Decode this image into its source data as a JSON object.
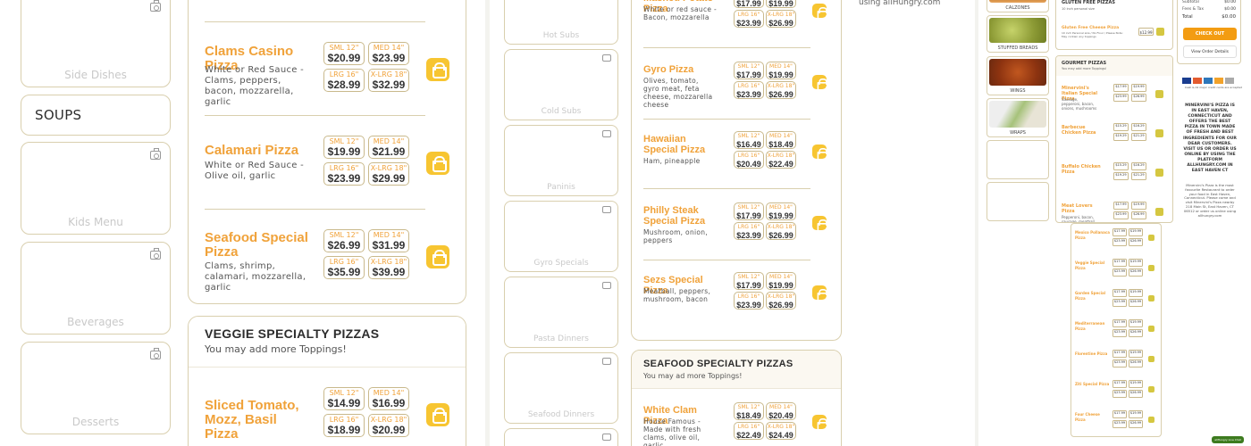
{
  "colors": {
    "accent": "#f0a23a",
    "cart": "#f7c531",
    "border": "#d9cfae",
    "checkout": "#f39c12"
  },
  "panel1": {
    "categories": [
      "Side Dishes",
      "SOUPS",
      "Kids Menu",
      "Beverages",
      "Desserts"
    ],
    "items": [
      {
        "name": "Clams Casino Pizza",
        "desc": "White or Red Sauce - Clams, peppers, bacon, mozzarella, garlic",
        "prices": [
          [
            "SML 12\"",
            "$20.99"
          ],
          [
            "MED 14\"",
            "$23.99"
          ],
          [
            "LRG 16\"",
            "$28.99"
          ],
          [
            "X-LRG 18\"",
            "$32.99"
          ]
        ]
      },
      {
        "name": "Calamari Pizza",
        "desc": "White or Red Sauce - Olive oil, garlic",
        "prices": [
          [
            "SML 12\"",
            "$19.99"
          ],
          [
            "MED 14\"",
            "$21.99"
          ],
          [
            "LRG 16\"",
            "$23.99"
          ],
          [
            "X-LRG 18\"",
            "$29.99"
          ]
        ]
      },
      {
        "name": "Seafood Special Pizza",
        "desc": "Clams, shrimp, calamari, mozzarella, garlic",
        "prices": [
          [
            "SML 12\"",
            "$26.99"
          ],
          [
            "MED 14\"",
            "$31.99"
          ],
          [
            "LRG 16\"",
            "$35.99"
          ],
          [
            "X-LRG 18\"",
            "$39.99"
          ]
        ]
      }
    ],
    "veggie": {
      "title": "VEGGIE SPECIALTY PIZZAS",
      "subtitle": "You may add more Toppings!",
      "item": {
        "name": "Sliced Tomato, Mozz, Basil Pizza",
        "prices": [
          [
            "SML 12\"",
            "$14.99"
          ],
          [
            "MED 14\"",
            "$16.99"
          ],
          [
            "LRG 16\"",
            "$18.99"
          ],
          [
            "X-LRG 18\"",
            "$20.99"
          ]
        ]
      }
    }
  },
  "panel2": {
    "categories": [
      "Hot Subs",
      "Cold Subs",
      "Paninis",
      "Gyro Specials",
      "Pasta Dinners",
      "Seafood Dinners",
      ""
    ],
    "items": [
      {
        "name": "Mashed Potato Pizza",
        "desc": "White or red sauce - Bacon, mozzarella",
        "prices": [
          [
            "SML 12\"",
            "$17.99"
          ],
          [
            "MED 14\"",
            "$19.99"
          ],
          [
            "LRG 16\"",
            "$23.99"
          ],
          [
            "X-LRG 18\"",
            "$26.99"
          ]
        ]
      },
      {
        "name": "Gyro Pizza",
        "desc": "Olives, tomato, gyro meat, feta cheese, mozzarella cheese",
        "prices": [
          [
            "SML 12\"",
            "$17.99"
          ],
          [
            "MED 14\"",
            "$19.99"
          ],
          [
            "LRG 16\"",
            "$23.99"
          ],
          [
            "X-LRG 18\"",
            "$26.99"
          ]
        ]
      },
      {
        "name": "Hawaiian Special Pizza",
        "desc": "Ham, pineapple",
        "prices": [
          [
            "SML 12\"",
            "$16.49"
          ],
          [
            "MED 14\"",
            "$18.49"
          ],
          [
            "LRG 16\"",
            "$20.49"
          ],
          [
            "X-LRG 18\"",
            "$22.49"
          ]
        ]
      },
      {
        "name": "Philly Steak Special Pizza",
        "desc": "Mushroom, onion, peppers",
        "prices": [
          [
            "SML 12\"",
            "$17.99"
          ],
          [
            "MED 14\"",
            "$19.99"
          ],
          [
            "LRG 16\"",
            "$23.99"
          ],
          [
            "X-LRG 18\"",
            "$26.99"
          ]
        ]
      },
      {
        "name": "Sezs Special Pizza",
        "desc": "Meatball, peppers, mushroom, bacon",
        "prices": [
          [
            "SML 12\"",
            "$17.99"
          ],
          [
            "MED 14\"",
            "$19.99"
          ],
          [
            "LRG 16\"",
            "$23.99"
          ],
          [
            "X-LRG 18\"",
            "$26.99"
          ]
        ]
      }
    ],
    "seafood": {
      "title": "SEAFOOD SPECIALTY PIZZAS",
      "subtitle": "You may ad more Toppings!",
      "item": {
        "name": "White Clam Pizza",
        "desc": "House Famous - Made with fresh clams, olive oil, garlic",
        "prices": [
          [
            "SML 12\"",
            "$18.49"
          ],
          [
            "MED 14\"",
            "$20.49"
          ],
          [
            "LRG 16\"",
            "$22.49"
          ],
          [
            "X-LRG 18\"",
            "$24.49"
          ]
        ]
      }
    },
    "side_text": "using allHungry.com"
  },
  "panel3": {
    "thumbs": [
      "CALZONES",
      "STUFFED BREADS",
      "WINGS",
      "WRAPS",
      "",
      ""
    ],
    "gluten": {
      "title": "GLUTEN FREE PIZZAS",
      "sub": "10 inch personal size",
      "item": "Gluten Free Cheese Pizza",
      "item_desc": "10 inch Personal size / No Flour / Please Note: May contain any toppings",
      "price": "$12.99"
    },
    "gourmet": {
      "title": "GOURMET PIZZAS",
      "sub": "You may add more Toppings!"
    },
    "gourmet_items": [
      {
        "name": "Minervini's Italian Special Pizza",
        "desc": "Sausage, pepperoni, bacon, onions, mushrooms",
        "prices": [
          "$17.99",
          "$19.99",
          "$23.99",
          "$26.99"
        ]
      },
      {
        "name": "Barbecue Chicken Pizza",
        "desc": "",
        "prices": [
          "$15.29",
          "$16.29",
          "$19.29",
          "$21.29"
        ]
      },
      {
        "name": "Buffalo Chicken Pizza",
        "desc": "",
        "prices": [
          "$15.29",
          "$16.29",
          "$19.29",
          "$21.29"
        ]
      },
      {
        "name": "Meat Lovers Pizza",
        "desc": "Pepperoni, bacon, sausage, meatball",
        "prices": [
          "$17.99",
          "$19.99",
          "$23.99",
          "$26.99"
        ]
      }
    ],
    "lower_items": [
      {
        "name": "Mexico Pollanaca Pizza",
        "prices": [
          "$17.99",
          "$19.99",
          "$23.99",
          "$26.99"
        ]
      },
      {
        "name": "Veggie Special Pizza",
        "prices": [
          "$17.99",
          "$19.99",
          "$23.99",
          "$26.99"
        ]
      },
      {
        "name": "Garden Special Pizza",
        "prices": [
          "$17.99",
          "$19.99",
          "$23.99",
          "$26.99"
        ]
      },
      {
        "name": "Mediterranean Pizza",
        "prices": [
          "$17.99",
          "$19.99",
          "$23.99",
          "$26.99"
        ]
      },
      {
        "name": "Florentine Pizza",
        "prices": [
          "$17.99",
          "$19.99",
          "$23.99",
          "$26.99"
        ]
      },
      {
        "name": "Ziti Special Pizza",
        "prices": [
          "$17.99",
          "$19.99",
          "$23.99",
          "$26.99"
        ]
      },
      {
        "name": "Four Cheese Pizza",
        "prices": [
          "$17.99",
          "$19.99",
          "$23.99",
          "$26.99"
        ]
      }
    ],
    "order": {
      "subtotal_label": "Subtotal",
      "subtotal": "$0.00",
      "fees_label": "Fees & Tax",
      "fees": "$0.00",
      "total_label": "Total",
      "total": "$0.00",
      "checkout": "CHECK OUT",
      "view_order": "View Order Details",
      "cards_note": "Cash & All major credit cards are accepted"
    },
    "about": "MINERVINI'S PIZZA IS IN EAST HAVEN, CONNECTICUT AND OFFERS THE BEST PIZZA IN TOWN MADE OF FRESH AND BEST INGREDIENTS FOR OUR DEAR CUSTOMERS. VISIT US OR ORDER US ONLINE BY USING THE PLATFORM ALLHUNGRY.COM IN EAST HAVEN CT",
    "about_small": "Minervini's Pizza is the most favourite Restaurant to order your food in East Haven, Connecticut. Please come and visit Minervini's Pizza nearby 218 Main St, East Haven, CT 06512 or order us online using allhungry.com",
    "badge": "allHungry Live Chat"
  }
}
